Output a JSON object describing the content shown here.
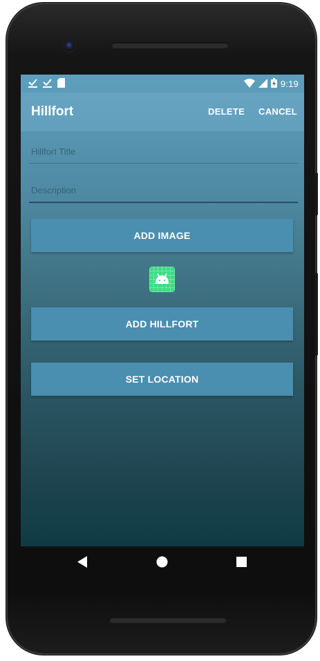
{
  "status_bar": {
    "time": "9:19",
    "icons_left": [
      "download-done-icon",
      "download-done-icon",
      "sd-card-icon"
    ],
    "icons_right": [
      "wifi-icon",
      "cell-signal-icon",
      "battery-icon"
    ]
  },
  "app_bar": {
    "title": "Hillfort",
    "delete_label": "DELETE",
    "cancel_label": "CANCEL"
  },
  "form": {
    "title_placeholder": "Hillfort Title",
    "title_value": "",
    "description_placeholder": "Description",
    "description_value": ""
  },
  "buttons": {
    "add_image": "ADD IMAGE",
    "add_hillfort": "ADD HILLFORT",
    "set_location": "SET LOCATION"
  },
  "image_preview": {
    "icon": "android-icon",
    "color": "#3ddc84"
  },
  "nav_bar": {
    "icons": [
      "back-icon",
      "home-icon",
      "recents-icon"
    ]
  },
  "colors": {
    "app_bar": "#5e9fbd",
    "button": "#4a8eb0",
    "background_bottom": "#0f3a44"
  }
}
